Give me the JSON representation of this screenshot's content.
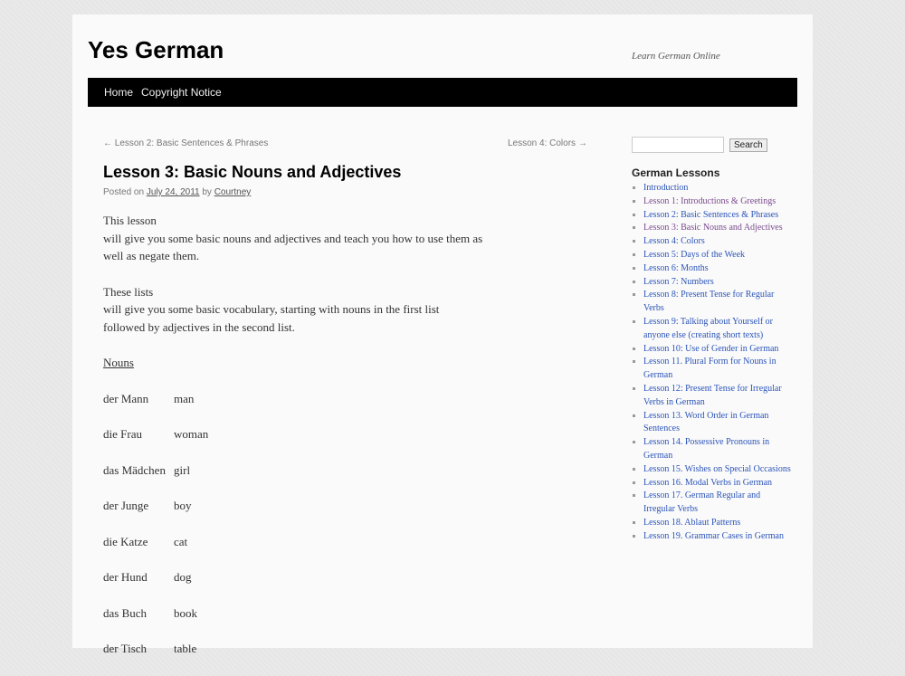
{
  "site": {
    "title": "Yes German",
    "description": "Learn German Online"
  },
  "nav": {
    "home": "Home",
    "copyright": "Copyright Notice"
  },
  "post_nav": {
    "prev": "← Lesson 2: Basic Sentences & Phrases",
    "next": "Lesson 4: Colors →"
  },
  "post": {
    "title": "Lesson 3: Basic Nouns and Adjectives",
    "meta_prefix": "Posted on",
    "date": "July 24, 2011",
    "by": "by",
    "author": "Courtney",
    "intro_line1": "This lesson",
    "intro_line2": "will give you some basic nouns and adjectives and teach you how to use them as",
    "intro_line3": "well as negate them.",
    "lists_line1": "These lists",
    "lists_line2": "will give you some basic vocabulary, starting with nouns in the first list",
    "lists_line3": "followed by adjectives in the second list.",
    "nouns_heading": "Nouns",
    "nouns": [
      {
        "de": "der Mann",
        "en": "man"
      },
      {
        "de": "die Frau",
        "en": "woman"
      },
      {
        "de": "das Mädchen",
        "en": "girl"
      },
      {
        "de": "der Junge",
        "en": "boy"
      },
      {
        "de": "die Katze",
        "en": "cat"
      },
      {
        "de": "der Hund",
        "en": "dog"
      },
      {
        "de": "das Buch",
        "en": "book"
      },
      {
        "de": "der Tisch",
        "en": "table"
      }
    ]
  },
  "sidebar": {
    "search_button": "Search",
    "search_value": "",
    "widget_title": "German Lessons",
    "lessons": [
      "Introduction",
      "Lesson 1: Introductions & Greetings",
      "Lesson 2: Basic Sentences & Phrases",
      "Lesson 3: Basic Nouns and Adjectives",
      "Lesson 4: Colors",
      "Lesson 5: Days of the Week",
      "Lesson 6: Months",
      "Lesson 7: Numbers",
      "Lesson 8: Present Tense for Regular Verbs",
      "Lesson 9: Talking about Yourself or anyone else (creating short texts)",
      "Lesson 10: Use of Gender in German",
      "Lesson 11. Plural Form for Nouns in German",
      "Lesson 12: Present Tense for Irregular Verbs in German",
      "Lesson 13. Word Order in German Sentences",
      "Lesson 14. Possessive Pronouns in German",
      "Lesson 15. Wishes on Special Occasions",
      "Lesson 16. Modal Verbs in German",
      "Lesson 17. German Regular and Irregular Verbs",
      "Lesson 18. Ablaut Patterns",
      "Lesson 19. Grammar Cases in German"
    ]
  },
  "colors": {
    "link": "#2b54b8",
    "visited_link": "#7a4a8e",
    "menu_bar": "#000000"
  }
}
